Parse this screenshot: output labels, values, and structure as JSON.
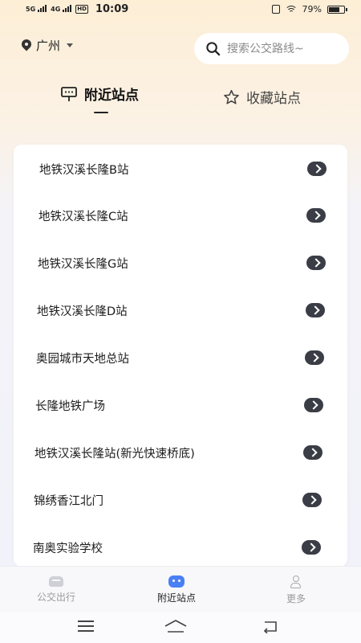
{
  "status_bar": {
    "net1": "5G",
    "net2": "4G",
    "hd": "HD",
    "time": "10:09",
    "battery": "79%",
    "battery_level": 0.79
  },
  "header": {
    "city": "广州",
    "search_placeholder": "搜索公交路线~"
  },
  "tabs": [
    {
      "label": "附近站点",
      "active": true,
      "icon": "bus-stop-sign-icon"
    },
    {
      "label": "收藏站点",
      "active": false,
      "icon": "star-icon"
    }
  ],
  "stations": [
    "地铁汉溪长隆B站",
    "地铁汉溪长隆C站",
    "地铁汉溪长隆G站",
    "地铁汉溪长隆D站",
    "奥园城市天地总站",
    "长隆地铁广场",
    "地铁汉溪长隆站(新光快速桥底)",
    "锦绣香江北门",
    "南奥实验学校"
  ],
  "bottom_nav": [
    {
      "label": "公交出行",
      "icon": "bus-icon",
      "active": false
    },
    {
      "label": "附近站点",
      "icon": "robot-icon",
      "active": true
    },
    {
      "label": "更多",
      "icon": "user-icon",
      "active": false
    }
  ],
  "system_nav": [
    "menu-icon",
    "home-icon",
    "back-icon"
  ],
  "colors": {
    "accent": "#4a7ff5",
    "arrow_bg": "#3a3d45",
    "header_gradient": "#fdeed6"
  }
}
